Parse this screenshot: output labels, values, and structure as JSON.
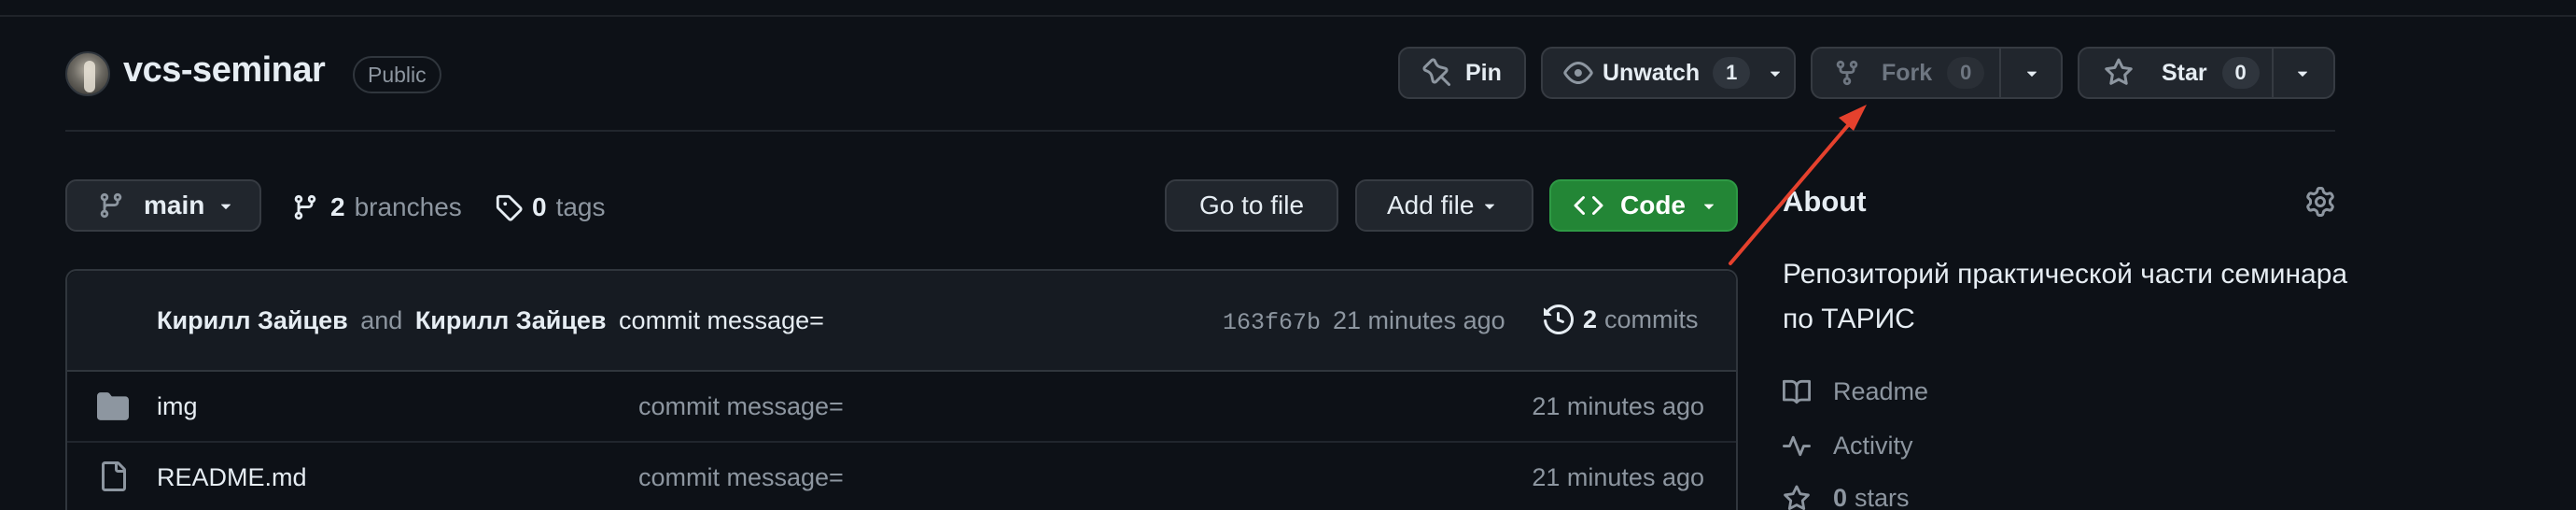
{
  "repo": {
    "name": "vcs-seminar",
    "visibility": "Public"
  },
  "actions": {
    "pin_label": "Pin",
    "unwatch_label": "Unwatch",
    "watch_count": "1",
    "fork_label": "Fork",
    "fork_count": "0",
    "star_label": "Star",
    "star_count": "0"
  },
  "branch_bar": {
    "branch": "main",
    "branches_count": "2",
    "branches_label": "branches",
    "tags_count": "0",
    "tags_label": "tags",
    "go_to_file": "Go to file",
    "add_file": "Add file",
    "code": "Code"
  },
  "latest_commit": {
    "author1": "Кирилл Зайцев",
    "and": "and",
    "author2": "Кирилл Зайцев",
    "message": "commit message=",
    "hash": "163f67b",
    "time": "21 minutes ago",
    "commits_count": "2",
    "commits_label": "commits"
  },
  "files": [
    {
      "name": "img",
      "type": "folder-icon",
      "message": "commit message=",
      "time": "21 minutes ago"
    },
    {
      "name": "README.md",
      "type": "file-icon",
      "message": "commit message=",
      "time": "21 minutes ago"
    }
  ],
  "about": {
    "title": "About",
    "description": "Репозиторий практической части семинара по ТАРИС",
    "readme": "Readme",
    "activity": "Activity",
    "stars_count": "0",
    "stars_label": "stars"
  },
  "colors": {
    "background": "#0d1117",
    "code_button": "#238636",
    "annotation_arrow": "#e5412d"
  }
}
